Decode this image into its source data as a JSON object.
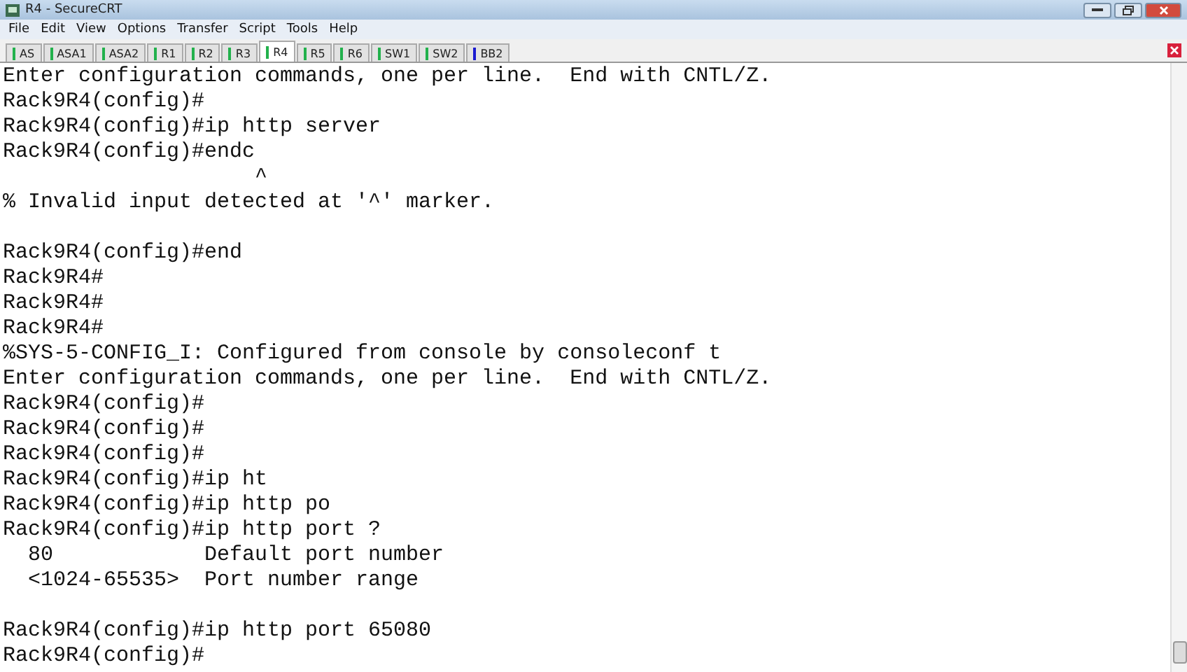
{
  "window": {
    "title": "R4 - SecureCRT"
  },
  "menu": [
    "File",
    "Edit",
    "View",
    "Options",
    "Transfer",
    "Script",
    "Tools",
    "Help"
  ],
  "tabs": [
    {
      "label": "AS",
      "selected": false,
      "color": "#22b14c"
    },
    {
      "label": "ASA1",
      "selected": false,
      "color": "#22b14c"
    },
    {
      "label": "ASA2",
      "selected": false,
      "color": "#22b14c"
    },
    {
      "label": "R1",
      "selected": false,
      "color": "#22b14c"
    },
    {
      "label": "R2",
      "selected": false,
      "color": "#22b14c"
    },
    {
      "label": "R3",
      "selected": false,
      "color": "#22b14c"
    },
    {
      "label": "R4",
      "selected": true,
      "color": "#22b14c"
    },
    {
      "label": "R5",
      "selected": false,
      "color": "#22b14c"
    },
    {
      "label": "R6",
      "selected": false,
      "color": "#22b14c"
    },
    {
      "label": "SW1",
      "selected": false,
      "color": "#22b14c"
    },
    {
      "label": "SW2",
      "selected": false,
      "color": "#22b14c"
    },
    {
      "label": "BB2",
      "selected": false,
      "color": "#1a1ad0"
    }
  ],
  "terminal": {
    "lines": [
      {
        "kind": "text",
        "text": "Enter configuration commands, one per line.  End with CNTL/Z."
      },
      {
        "kind": "text",
        "text": "Rack9R4(config)#"
      },
      {
        "kind": "text",
        "text": "Rack9R4(config)#ip http server"
      },
      {
        "kind": "text",
        "text": "Rack9R4(config)#endc"
      },
      {
        "kind": "text",
        "text": "                    ^"
      },
      {
        "kind": "text",
        "text": "% Invalid input detected at '^' marker."
      },
      {
        "kind": "blank"
      },
      {
        "kind": "text",
        "text": "Rack9R4(config)#end"
      },
      {
        "kind": "text",
        "text": "Rack9R4#"
      },
      {
        "kind": "text",
        "text": "Rack9R4#"
      },
      {
        "kind": "text",
        "text": "Rack9R4#"
      },
      {
        "kind": "text",
        "text": "%SYS-5-CONFIG_I: Configured from console by consoleconf t"
      },
      {
        "kind": "text",
        "text": "Enter configuration commands, one per line.  End with CNTL/Z."
      },
      {
        "kind": "text",
        "text": "Rack9R4(config)#"
      },
      {
        "kind": "text",
        "text": "Rack9R4(config)#"
      },
      {
        "kind": "text",
        "text": "Rack9R4(config)#"
      },
      {
        "kind": "text",
        "text": "Rack9R4(config)#ip ht"
      },
      {
        "kind": "text",
        "text": "Rack9R4(config)#ip http po"
      },
      {
        "kind": "text",
        "text": "Rack9R4(config)#ip http port ?"
      },
      {
        "kind": "text",
        "text": "  80            Default port number"
      },
      {
        "kind": "text",
        "text": "  <1024-65535>  Port number range"
      },
      {
        "kind": "blank"
      },
      {
        "kind": "text",
        "text": "Rack9R4(config)#ip http port 65080"
      },
      {
        "kind": "text",
        "text": "Rack9R4(config)#"
      }
    ]
  }
}
